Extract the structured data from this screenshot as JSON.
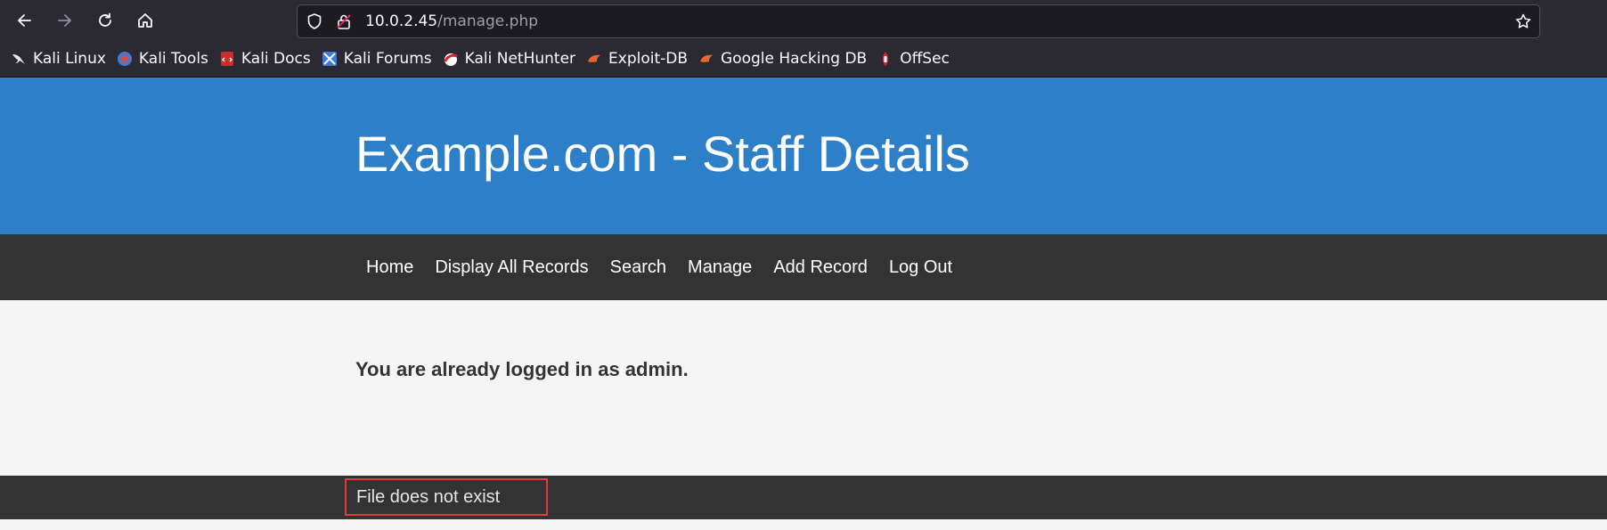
{
  "browser": {
    "url_host": "10.0.2.45",
    "url_path": "/manage.php"
  },
  "bookmarks": [
    {
      "label": "Kali Linux",
      "icon": "kali-dragon-icon"
    },
    {
      "label": "Kali Tools",
      "icon": "kali-tools-icon"
    },
    {
      "label": "Kali Docs",
      "icon": "kali-docs-icon"
    },
    {
      "label": "Kali Forums",
      "icon": "kali-forums-icon"
    },
    {
      "label": "Kali NetHunter",
      "icon": "kali-nethunter-icon"
    },
    {
      "label": "Exploit-DB",
      "icon": "exploit-db-icon"
    },
    {
      "label": "Google Hacking DB",
      "icon": "ghdb-icon"
    },
    {
      "label": "OffSec",
      "icon": "offsec-icon"
    }
  ],
  "site": {
    "title": "Example.com - Staff Details",
    "nav": [
      "Home",
      "Display All Records",
      "Search",
      "Manage",
      "Add Record",
      "Log Out"
    ],
    "message": "You are already logged in as admin.",
    "footer_error": "File does not exist"
  },
  "colors": {
    "header_bg": "#2d80c8",
    "nav_bg": "#333333",
    "error_outline": "#e03a3a"
  }
}
